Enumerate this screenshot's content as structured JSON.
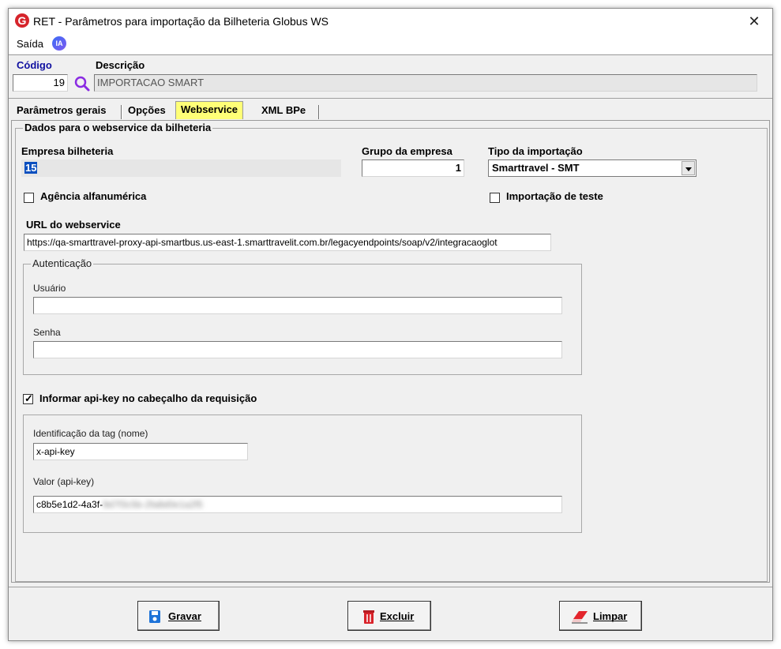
{
  "window": {
    "title": "RET - Parâmetros para importação da Bilheteria Globus WS",
    "app_icon_letter": "G",
    "close_glyph": "✕"
  },
  "menu": {
    "saida_label": "Saída",
    "ia_badge": "IA"
  },
  "header": {
    "codigo_label": "Código",
    "codigo_value": "19",
    "descricao_label": "Descrição",
    "descricao_value": "IMPORTACAO SMART"
  },
  "tabs": [
    {
      "label": "Parâmetros gerais"
    },
    {
      "label": "Opções"
    },
    {
      "label": "Webservice",
      "active": true
    },
    {
      "label": "XML BPe"
    }
  ],
  "webservice": {
    "group_title": "Dados para o webservice da bilheteria",
    "empresa_label": "Empresa bilheteria",
    "empresa_value": "15",
    "grupo_label": "Grupo da empresa",
    "grupo_value": "1",
    "tipo_label": "Tipo da importação",
    "tipo_value": "Smarttravel - SMT",
    "agencia_label": "Agência alfanumérica",
    "agencia_checked": false,
    "teste_label": "Importação de teste",
    "teste_checked": false,
    "url_label": "URL do webservice",
    "url_value": "https://qa-smarttravel-proxy-api-smartbus.us-east-1.smarttravelit.com.br/legacyendpoints/soap/v2/integracaoglot",
    "auth": {
      "title": "Autenticação",
      "usuario_label": "Usuário",
      "usuario_value": "",
      "senha_label": "Senha",
      "senha_value": ""
    },
    "apikey": {
      "checkbox_label": "Informar api-key no cabeçalho da requisição",
      "checked": true,
      "tag_label": "Identificação da tag (nome)",
      "tag_value": "x-api-key",
      "valor_label": "Valor (api-key)",
      "valor_visible": "c8b5e1d2-4a3f-",
      "valor_blurred": "9d7f3c5b-2fa8d0e1a2f5"
    }
  },
  "buttons": {
    "gravar": "Gravar",
    "excluir": "Excluir",
    "limpar": "Limpar"
  },
  "colors": {
    "active_tab": "#ffff77",
    "label_blue": "#1010a0",
    "brand_red": "#d6242b"
  }
}
